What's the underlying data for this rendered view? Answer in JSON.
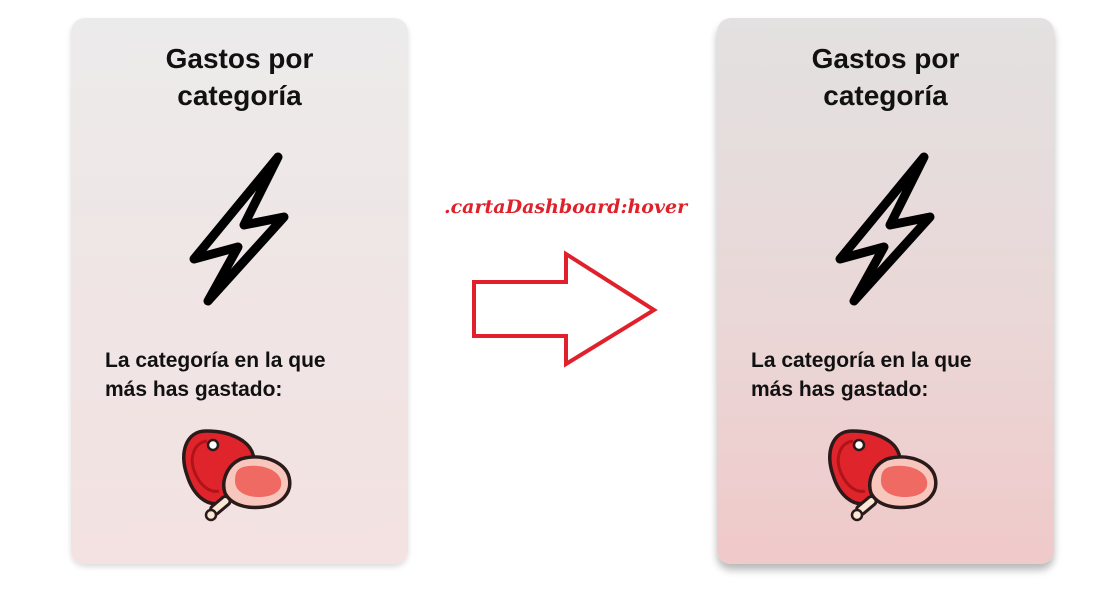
{
  "cards": [
    {
      "state": "normal",
      "title": "Gastos por categoría",
      "text": "La categoría en la que más has gastado:",
      "category_icon": "bolt-icon",
      "top_category_icon": "meat-icon"
    },
    {
      "state": "hover",
      "title": "Gastos por categoría",
      "text": "La categoría en la que más has gastado:",
      "category_icon": "bolt-icon",
      "top_category_icon": "meat-icon"
    }
  ],
  "annotation": {
    "label": ".cartaDashboard:hover",
    "color": "#e0202a",
    "arrow_icon": "arrow-right-icon"
  },
  "colors": {
    "normal_card_top": "#ecebeb",
    "normal_card_bottom": "#f4e2e2",
    "hover_card_top": "#e3e1e1",
    "hover_card_bottom": "#f0c9c9",
    "text": "#111111"
  }
}
